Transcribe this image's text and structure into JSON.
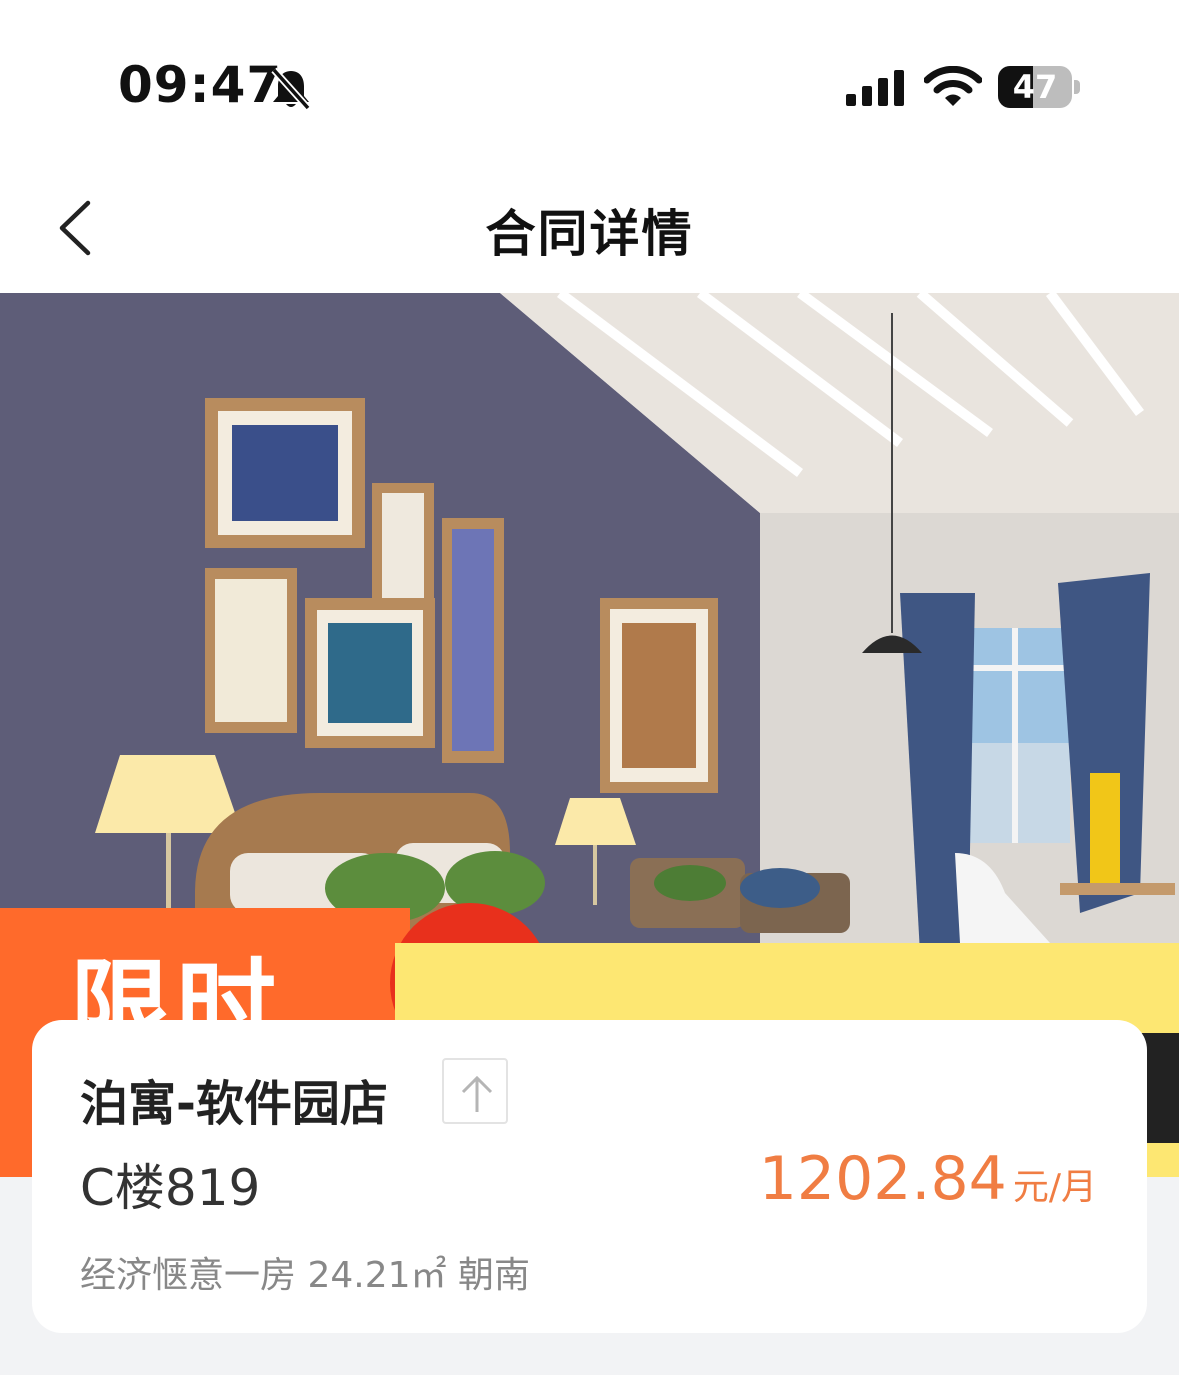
{
  "status_bar": {
    "time": "09:47",
    "battery": "47",
    "battery_level": 0.47
  },
  "nav": {
    "title": "合同详情"
  },
  "banner": {
    "promo_text": "限时"
  },
  "listing": {
    "store_name": "泊寓-软件园店",
    "room": "C楼819",
    "price": "1202.84",
    "price_unit": "元/月",
    "description": "经济惬意一房  24.21㎡  朝南"
  },
  "colors": {
    "accent": "#f07d43",
    "promo_orange": "#ff6a2b",
    "promo_yellow": "#fde772"
  }
}
